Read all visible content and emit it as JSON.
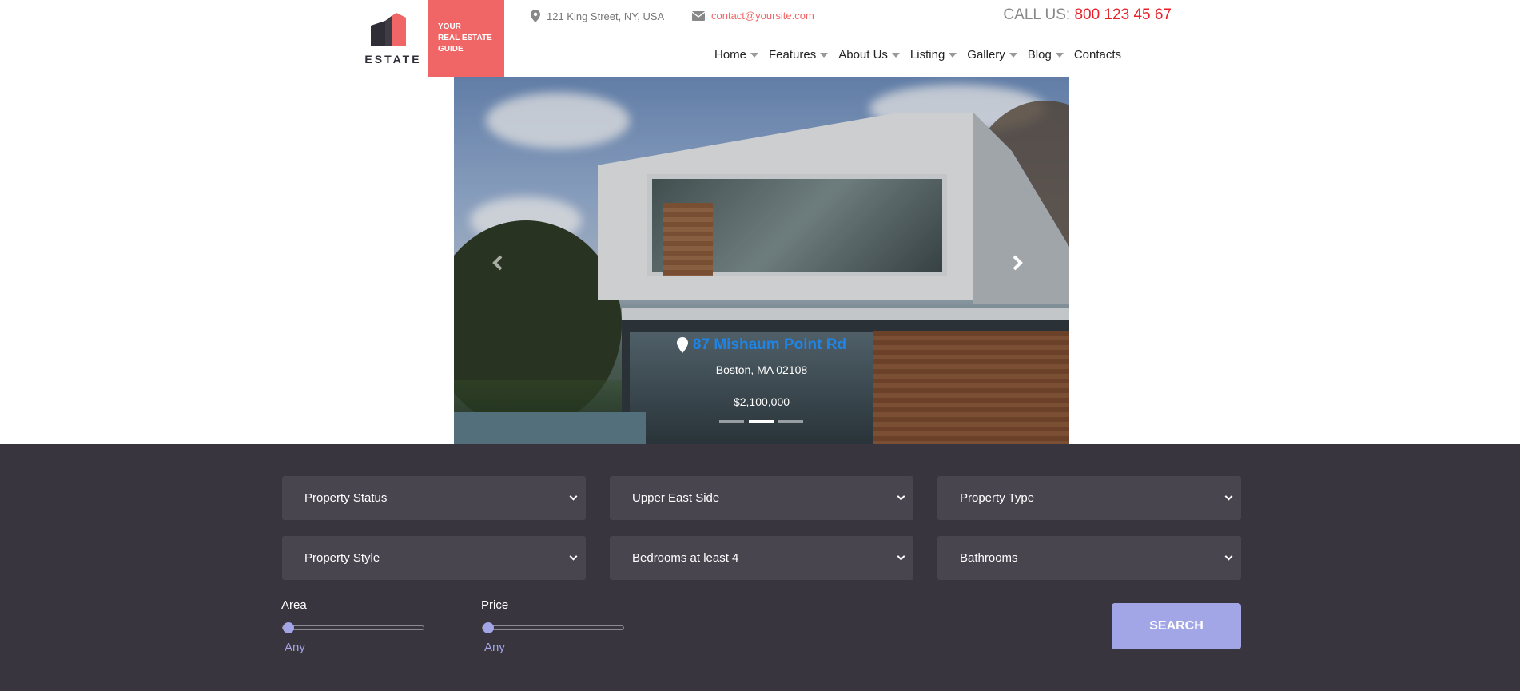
{
  "brand": {
    "logo_text": "ESTATE",
    "tagline": [
      "YOUR",
      "REAL ESTATE",
      "GUIDE"
    ],
    "accent_color": "#f06666"
  },
  "topbar": {
    "address": "121 King Street, NY, USA",
    "email": "contact@yoursite.com",
    "call_label": "CALL US:",
    "call_number": "800 123 45 67"
  },
  "nav": {
    "items": [
      {
        "label": "Home",
        "has_dropdown": true
      },
      {
        "label": "Features",
        "has_dropdown": true
      },
      {
        "label": "About Us",
        "has_dropdown": true
      },
      {
        "label": "Listing",
        "has_dropdown": true
      },
      {
        "label": "Gallery",
        "has_dropdown": true
      },
      {
        "label": "Blog",
        "has_dropdown": true
      },
      {
        "label": "Contacts",
        "has_dropdown": false
      }
    ]
  },
  "slider": {
    "street": "87 Mishaum Point Rd",
    "city": "Boston, MA 02108",
    "price": "$2,100,000",
    "slide_count": 3,
    "active_slide": 2
  },
  "search": {
    "selects": [
      {
        "label": "Property Status"
      },
      {
        "label": "Upper East Side"
      },
      {
        "label": "Property Type"
      },
      {
        "label": "Property Style"
      },
      {
        "label": "Bedrooms at least 4"
      },
      {
        "label": "Bathrooms"
      }
    ],
    "area": {
      "label": "Area",
      "value": "Any"
    },
    "price": {
      "label": "Price",
      "value": "Any"
    },
    "button_label": "SEARCH",
    "button_color": "#a3a6e6"
  }
}
